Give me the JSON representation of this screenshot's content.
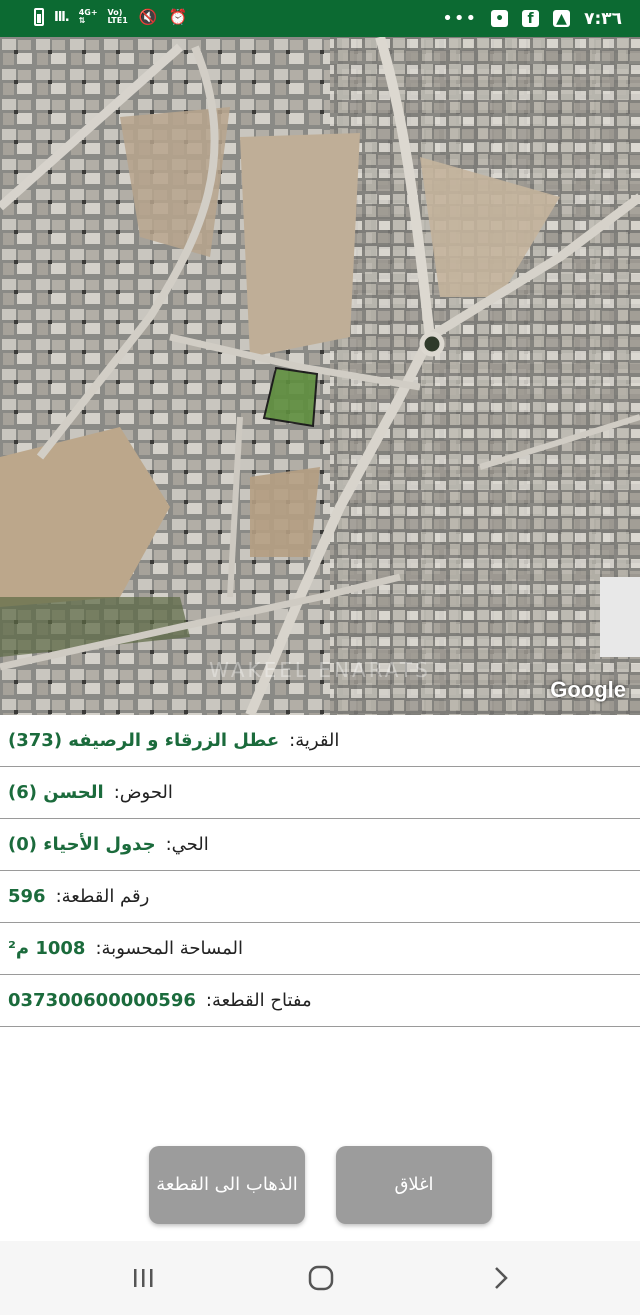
{
  "status_bar": {
    "time": "٧:٣٦",
    "network_top": "4G+",
    "network_bottom": "LTE1",
    "volte_top": "Vo)",
    "icons": [
      "battery-icon",
      "signal-icon",
      "mute-icon",
      "alarm-icon",
      "more-icon",
      "messenger-icon",
      "facebook-icon",
      "gallery-icon"
    ]
  },
  "map": {
    "attribution": "Google",
    "watermark": "WAKEEL ENARATS"
  },
  "parcel_info": {
    "village": {
      "label": "القرية:",
      "value": "عطل الزرقاء و الرصيفه (373)"
    },
    "basin": {
      "label": "الحوض:",
      "value": "الحسن (6)"
    },
    "district": {
      "label": "الحي:",
      "value": "جدول الأحياء (0)"
    },
    "plot_number": {
      "label": "رقم القطعة:",
      "value": "596"
    },
    "area": {
      "label": "المساحة المحسوبة:",
      "value": "1008 م²"
    },
    "plot_key": {
      "label": "مفتاح القطعة:",
      "value": "037300600000596"
    }
  },
  "buttons": {
    "go_to_plot": "الذهاب الى القطعة",
    "close": "اغلاق"
  },
  "colors": {
    "status_bar": "#0c6a32",
    "value_text": "#1b6b3c",
    "button": "#9c9c9c",
    "parcel_fill": "#5f8f3f"
  }
}
